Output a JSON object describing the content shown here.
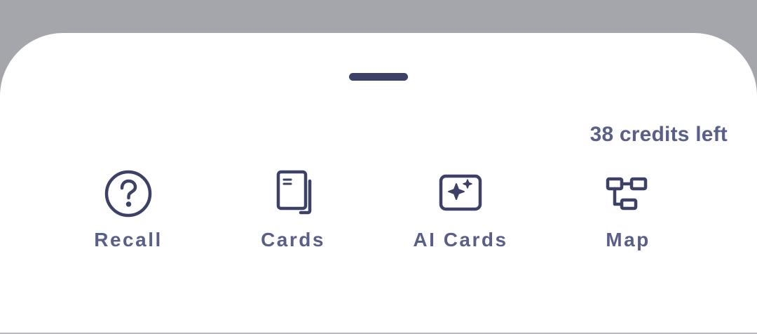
{
  "sheet": {
    "credits_text": "38 credits left"
  },
  "actions": [
    {
      "label": "Recall",
      "icon": "question-circle-icon"
    },
    {
      "label": "Cards",
      "icon": "cards-stack-icon"
    },
    {
      "label": "AI Cards",
      "icon": "ai-sparkle-icon"
    },
    {
      "label": "Map",
      "icon": "map-hierarchy-icon"
    }
  ],
  "colors": {
    "backdrop": "#a5a6ab",
    "sheet": "#ffffff",
    "icon": "#3c4165",
    "text": "#5a5f88"
  }
}
